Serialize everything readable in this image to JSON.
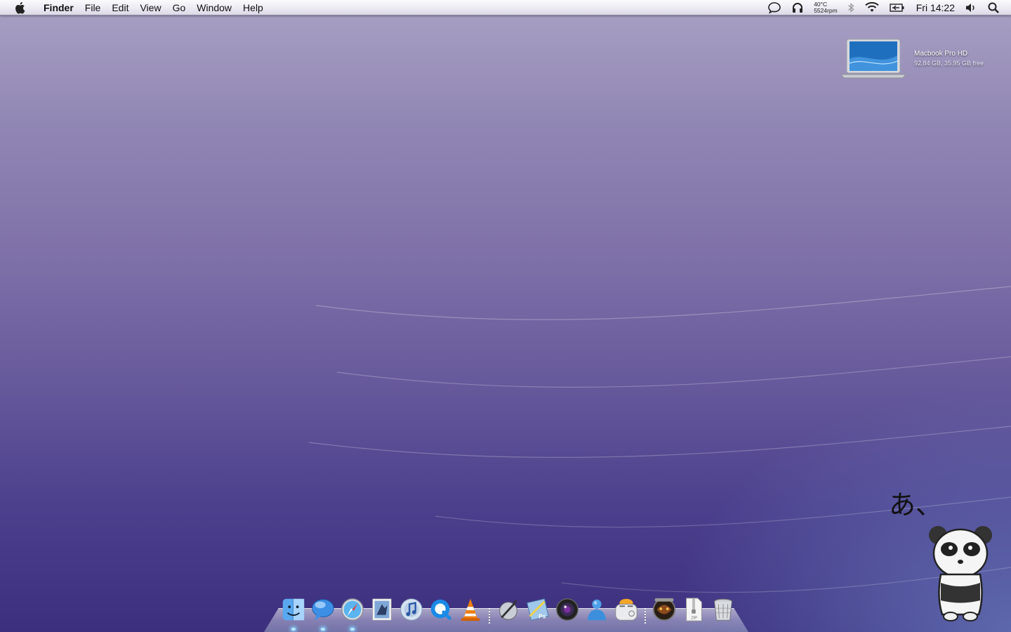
{
  "menubar": {
    "app_name": "Finder",
    "menus": [
      "File",
      "Edit",
      "View",
      "Go",
      "Window",
      "Help"
    ],
    "status": {
      "temperature": "40°C",
      "fan_speed": "5524rpm",
      "clock": "Fri 14:22"
    },
    "icons": [
      "chat-bubble-icon",
      "headphones-icon",
      "bluetooth-icon",
      "wifi-icon",
      "battery-icon",
      "volume-icon",
      "spotlight-search-icon"
    ]
  },
  "desktop": {
    "drive": {
      "name": "Macbook Pro HD",
      "info": "92.84 GB, 35.95 GB free"
    },
    "decoration_text": "あ、"
  },
  "dock": {
    "items": [
      {
        "name": "finder",
        "running": true
      },
      {
        "name": "ichat",
        "running": true
      },
      {
        "name": "safari",
        "running": true
      },
      {
        "name": "mail",
        "running": false
      },
      {
        "name": "itunes",
        "running": false
      },
      {
        "name": "quicktime",
        "running": false
      },
      {
        "name": "vlc",
        "running": false
      },
      {
        "name": "script-editor",
        "running": false
      },
      {
        "name": "photoshop",
        "running": false
      },
      {
        "name": "photo-booth",
        "running": false
      },
      {
        "name": "messenger",
        "running": false
      },
      {
        "name": "toaster",
        "running": false
      },
      {
        "name": "game-app",
        "running": false
      },
      {
        "name": "zip-archive",
        "running": false
      },
      {
        "name": "trash",
        "running": false
      }
    ],
    "zip_label": "ZIP",
    "ps_label": "Ps"
  },
  "colors": {
    "desktop_top": "#a9a1c4",
    "desktop_bottom": "#3c2f7e",
    "menubar": "#eceaf3",
    "running_indicator": "#7fd0ff"
  }
}
